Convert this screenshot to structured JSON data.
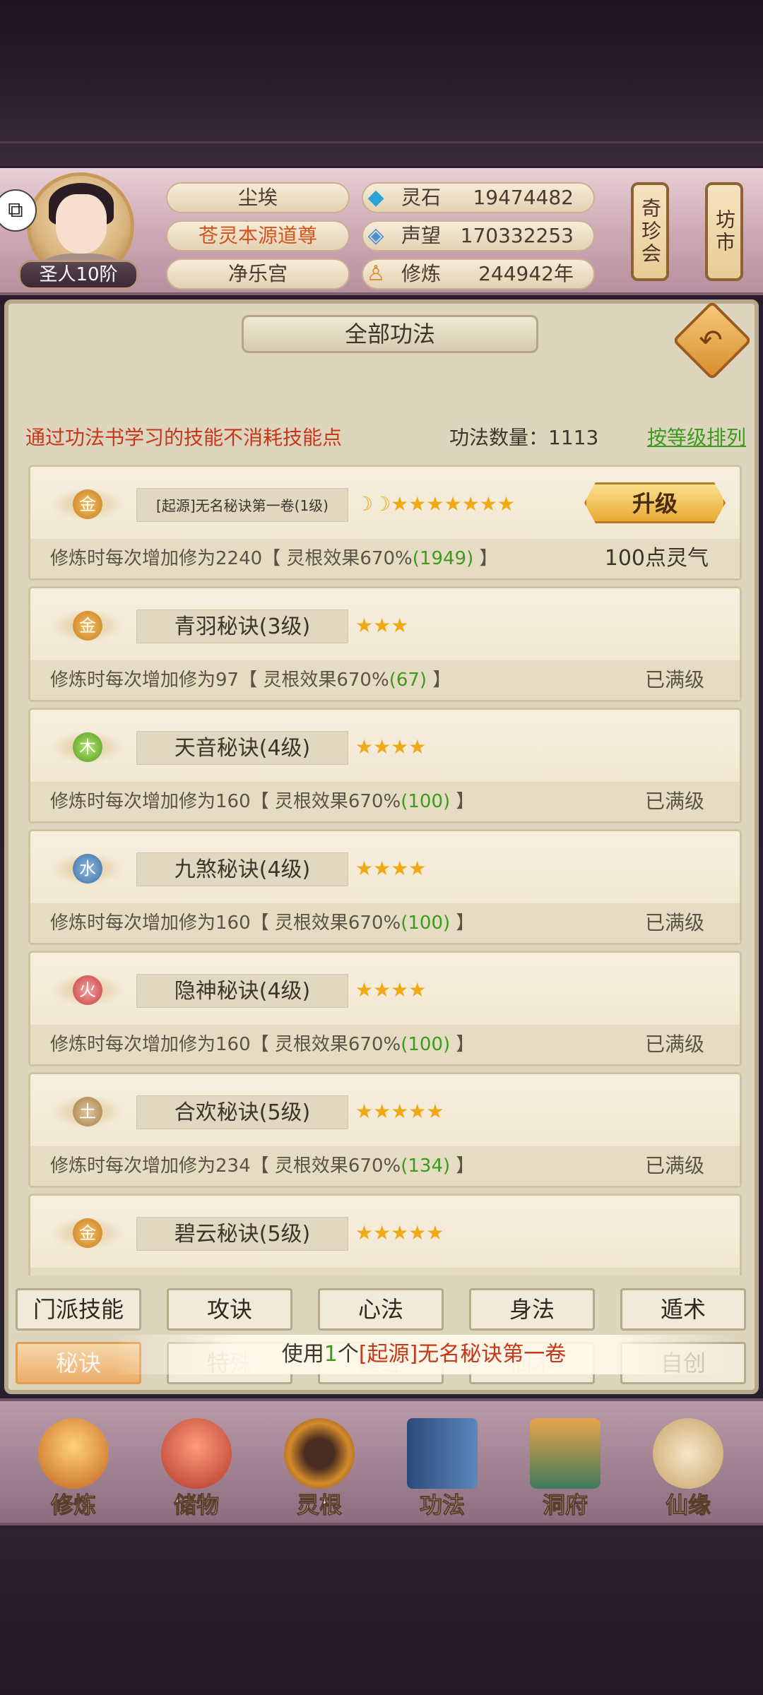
{
  "header": {
    "rank_badge": "圣人10阶",
    "share_icon": "share-icon",
    "names": [
      "尘埃",
      "苍灵本源道尊",
      "净乐宫"
    ],
    "resources": [
      {
        "icon": "spirit-stone-icon",
        "label": "灵石",
        "value": "19474482"
      },
      {
        "icon": "reputation-icon",
        "label": "声望",
        "value": "170332253"
      },
      {
        "icon": "cultivation-icon",
        "label": "修炼",
        "value": "244942年"
      }
    ],
    "scrolls": [
      "奇珍会",
      "坊市"
    ]
  },
  "main": {
    "title": "全部功法",
    "back_icon": "back-arrow-icon",
    "notice": "通过功法书学习的技能不消耗技能点",
    "count_label": "功法数量：1113",
    "sort_link": "按等级排列"
  },
  "skills": [
    {
      "element": "金",
      "name": "[起源]无名秘诀第一卷(1级)",
      "rating": "☽☽★★★★★★★",
      "desc": "修炼时每次增加修为2240【 灵根效果670%",
      "bonus": "(1949)",
      "desc_end": " 】",
      "upgrade": "升级",
      "cost": "100点灵气"
    },
    {
      "element": "金",
      "name": "青羽秘诀(3级)",
      "rating": "★★★",
      "desc": "修炼时每次增加修为97【 灵根效果670%",
      "bonus": "(67)",
      "desc_end": " 】",
      "state": "已满级"
    },
    {
      "element": "木",
      "name": "天音秘诀(4级)",
      "rating": "★★★★",
      "desc": "修炼时每次增加修为160【 灵根效果670%",
      "bonus": "(100)",
      "desc_end": " 】",
      "state": "已满级"
    },
    {
      "element": "水",
      "name": "九煞秘诀(4级)",
      "rating": "★★★★",
      "desc": "修炼时每次增加修为160【 灵根效果670%",
      "bonus": "(100)",
      "desc_end": " 】",
      "state": "已满级"
    },
    {
      "element": "火",
      "name": "隐神秘诀(4级)",
      "rating": "★★★★",
      "desc": "修炼时每次增加修为160【 灵根效果670%",
      "bonus": "(100)",
      "desc_end": " 】",
      "state": "已满级"
    },
    {
      "element": "土",
      "name": "合欢秘诀(5级)",
      "rating": "★★★★★",
      "desc": "修炼时每次增加修为234【 灵根效果670%",
      "bonus": "(134)",
      "desc_end": " 】",
      "state": "已满级"
    },
    {
      "element": "金",
      "name": "碧云秘诀(5级)",
      "rating": "★★★★★"
    }
  ],
  "tabs": {
    "row1": [
      "门派技能",
      "攻诀",
      "心法",
      "身法",
      "遁术"
    ],
    "row2": [
      "秘诀",
      "特殊",
      "真经",
      "仙术",
      "自创"
    ]
  },
  "toast": {
    "prefix": "使用",
    "num": "1",
    "mid": "个",
    "item": "[起源]无名秘诀第一卷"
  },
  "bottom_nav": [
    "修炼",
    "储物",
    "灵根",
    "功法",
    "洞府",
    "仙缘"
  ],
  "colors": {
    "accent_red": "#c7371a",
    "accent_green": "#3e9a1e",
    "gold": "#f0a915"
  }
}
